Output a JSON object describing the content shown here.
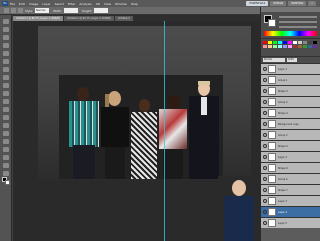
{
  "app": {
    "logo": "Ps"
  },
  "menu": [
    "File",
    "Edit",
    "Image",
    "Layer",
    "Select",
    "Filter",
    "Analysis",
    "3D",
    "View",
    "Window",
    "Help"
  ],
  "workspaces": [
    "ESSENTIALS",
    "DESIGN",
    "PAINTING",
    "»"
  ],
  "options": {
    "style_label": "Style:",
    "style_value": "Normal",
    "width_label": "Width:",
    "height_label": "Height:"
  },
  "tabs": [
    "Untitled-1 @ 66.7% (Layer 1, RGB/8)",
    "Untitled-2 @ 66.7% (Layer 2, RGB/8)",
    "Untitled-3"
  ],
  "layers_panel": {
    "blend_mode": "Normal",
    "opacity": "100%",
    "rows": [
      "Layer 1",
      "Group 1",
      "Shape 3",
      "Group 2",
      "Shape 4",
      "Background copy",
      "Group 3",
      "Shape 5",
      "Layer 2",
      "Shape 6",
      "Group 4",
      "Shape 7",
      "Layer 3",
      "Layer 4",
      "Layer 5",
      "Background"
    ]
  },
  "colors": {
    "accent": "#3d6ea3",
    "guide": "#3ac6d8",
    "canvas_dark": "#2a2a2a"
  }
}
